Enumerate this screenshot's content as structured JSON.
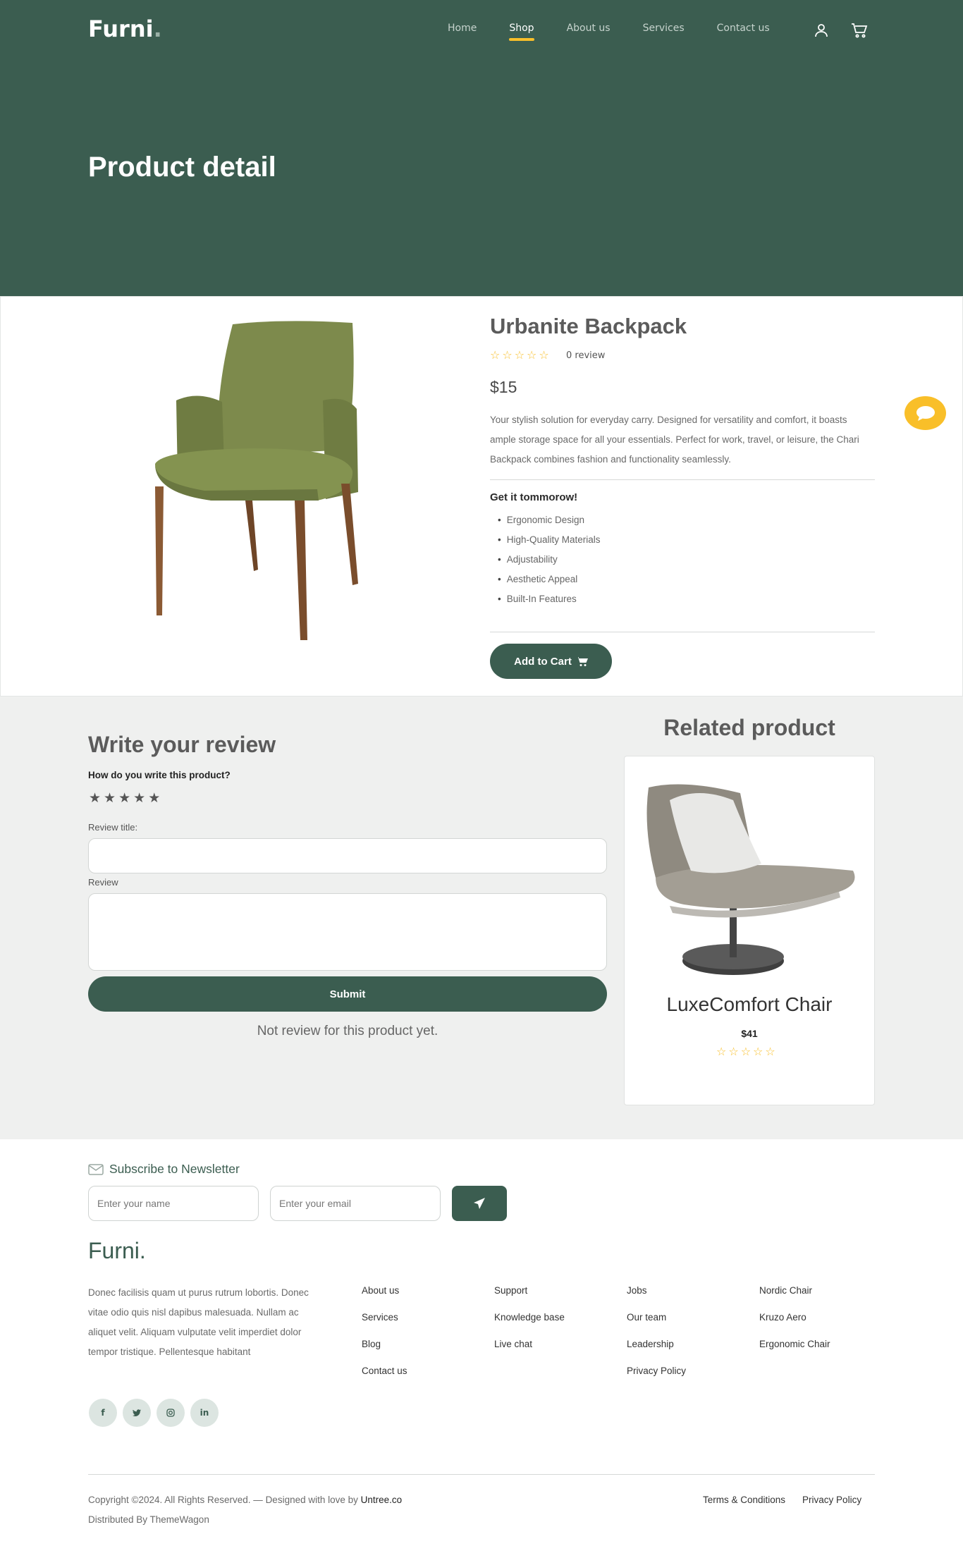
{
  "brand": {
    "name": "Furni",
    "dot": "."
  },
  "nav": {
    "items": [
      {
        "label": "Home",
        "active": false
      },
      {
        "label": "Shop",
        "active": true
      },
      {
        "label": "About us",
        "active": false
      },
      {
        "label": "Services",
        "active": false
      },
      {
        "label": "Contact us",
        "active": false
      }
    ],
    "icons": [
      "user-icon",
      "cart-icon"
    ]
  },
  "hero": {
    "title": "Product detail"
  },
  "product": {
    "name": "Urbanite Backpack",
    "rating": 0,
    "review_count": "0 review",
    "price": "$15",
    "description": "Your stylish solution for everyday carry. Designed for versatility and comfort, it boasts ample storage space for all your essentials. Perfect for work, travel, or leisure, the Chari Backpack combines fashion and functionality seamlessly.",
    "subheading": "Get it tommorow!",
    "features": [
      "Ergonomic Design",
      "High-Quality Materials",
      "Adjustability",
      "Aesthetic Appeal",
      "Built-In Features"
    ],
    "add_to_cart": "Add to Cart"
  },
  "review_form": {
    "title": "Write your review",
    "question": "How do you write this product?",
    "review_title_label": "Review title:",
    "review_label": "Review",
    "review_title_value": "",
    "review_value": "",
    "submit_label": "Submit",
    "empty_message": "Not review for this product yet."
  },
  "related": {
    "heading": "Related product",
    "name": "LuxeComfort Chair",
    "price": "$41",
    "rating": 0
  },
  "newsletter": {
    "label": "Subscribe to Newsletter",
    "name_placeholder": "Enter your name",
    "email_placeholder": "Enter your email"
  },
  "footer": {
    "logo": "Furni.",
    "about": "Donec facilisis quam ut purus rutrum lobortis. Donec vitae odio quis nisl dapibus malesuada. Nullam ac aliquet velit. Aliquam vulputate velit imperdiet dolor tempor tristique. Pellentesque habitant",
    "socials": [
      "f",
      "t",
      "ig",
      "in"
    ],
    "columns": [
      [
        "About us",
        "Services",
        "Blog",
        "Contact us"
      ],
      [
        "Support",
        "Knowledge base",
        "Live chat"
      ],
      [
        "Jobs",
        "Our team",
        "Leadership",
        "Privacy Policy"
      ],
      [
        "Nordic Chair",
        "Kruzo Aero",
        "Ergonomic Chair"
      ]
    ],
    "copyright_prefix": "Copyright ©2024. All Rights Reserved. — Designed with love by ",
    "copyright_link": "Untree.co",
    "distributed": "Distributed By ThemeWagon",
    "legal": [
      "Terms & Conditions",
      "Privacy Policy"
    ]
  },
  "colors": {
    "primary": "#3b5d50",
    "accent": "#f9bf29",
    "section_bg": "#eff0ef"
  }
}
